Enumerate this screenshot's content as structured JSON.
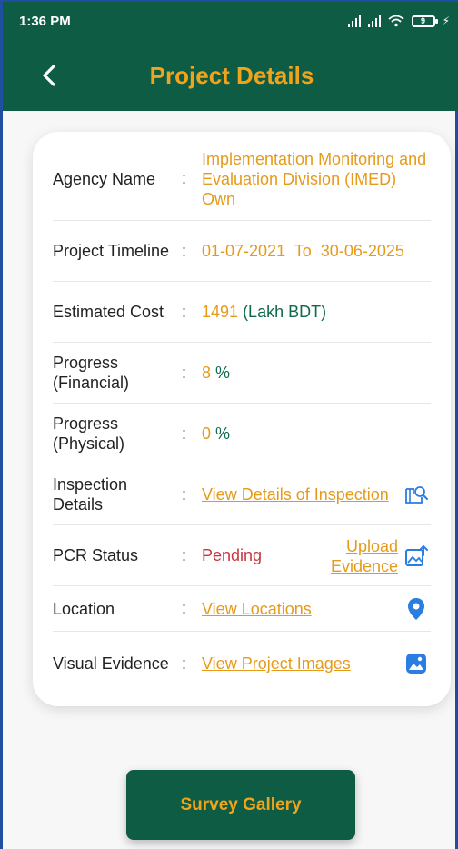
{
  "status_bar": {
    "time": "1:36 PM",
    "battery": "9"
  },
  "app_bar": {
    "title": "Project Details"
  },
  "colon": ":",
  "details": {
    "agency": {
      "label": "Agency Name",
      "value": "Implementation Monitoring and Evaluation Division (IMED) Own"
    },
    "timeline": {
      "label": "Project Timeline",
      "start": "01-07-2021",
      "to": "To",
      "end": "30-06-2025"
    },
    "cost": {
      "label": "Estimated Cost",
      "value": "1491",
      "unit": "(Lakh BDT)"
    },
    "financial": {
      "label": "Progress (Financial)",
      "value": "8",
      "unit": "%"
    },
    "physical": {
      "label": "Progress (Physical)",
      "value": "0",
      "unit": "%"
    },
    "inspection": {
      "label": "Inspection Details",
      "link": "View Details of Inspection"
    },
    "pcr": {
      "label": "PCR Status",
      "value": "Pending",
      "upload": "Upload Evidence"
    },
    "location": {
      "label": "Location",
      "link": "View Locations"
    },
    "visual": {
      "label": "Visual Evidence",
      "link": "View Project Images"
    }
  },
  "survey_button": "Survey Gallery",
  "colors": {
    "primary": "#0f5c45",
    "accent": "#f0a41c",
    "pending": "#c8363d",
    "icon_blue": "#2a7de1"
  }
}
